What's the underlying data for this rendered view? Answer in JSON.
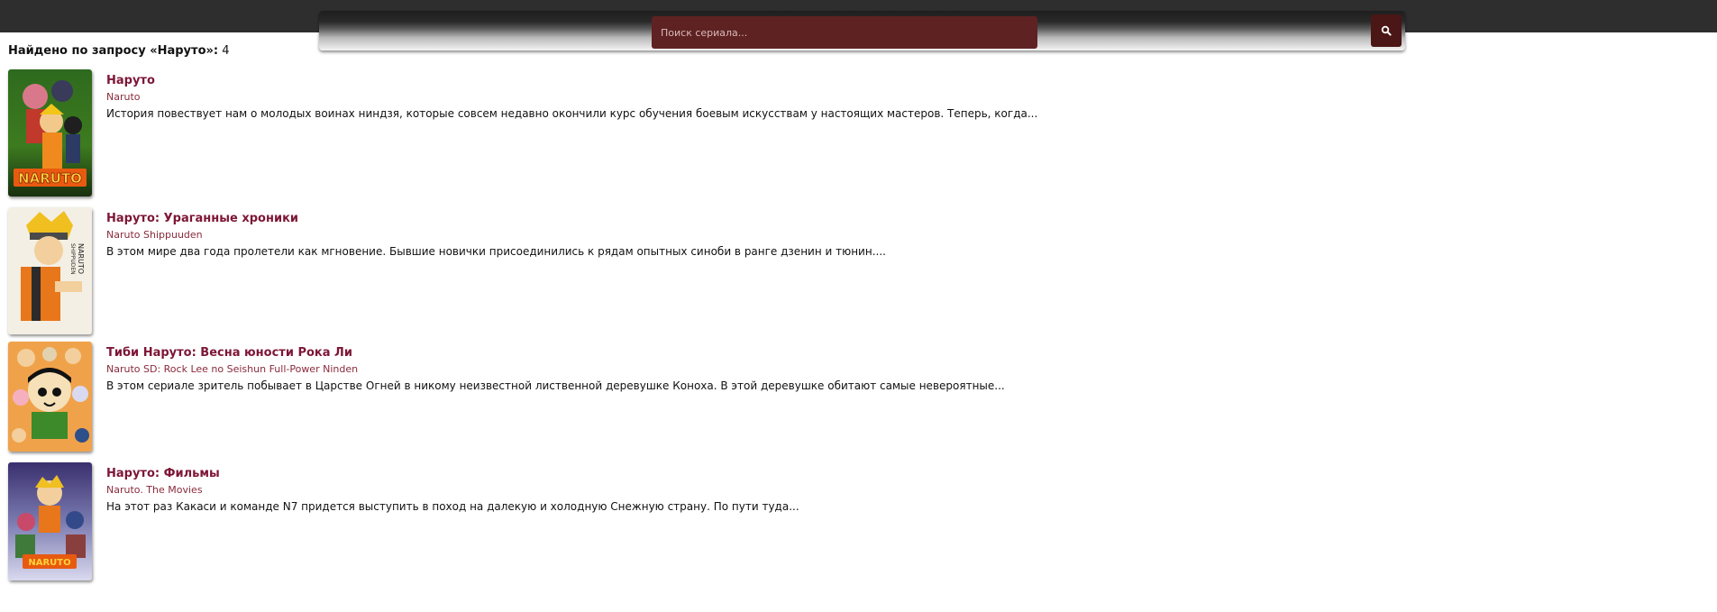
{
  "search": {
    "placeholder": "Поиск сериала...",
    "button_icon": "search-icon"
  },
  "summary": {
    "label": "Найдено по запросу «Наруто»:",
    "count": "4"
  },
  "colors": {
    "header_bg": "#2e2e2e",
    "search_input_bg": "#5e2222",
    "search_button_bg": "#4a1616",
    "title_color": "#7d1636"
  },
  "results": [
    {
      "title": "Наруто",
      "original": "Naruto",
      "description": "История повествует нам о молодых воинах ниндзя, которые совсем недавно окончили курс обучения боевым искусствам у настоящих мастеров. Теперь, когда..."
    },
    {
      "title": "Наруто: Ураганные хроники",
      "original": "Naruto Shippuuden",
      "description": "В этом мире два года пролетели как мгновение. Бывшие новички присоединились к рядам опытных синоби в ранге дзенин и тюнин...."
    },
    {
      "title": "Тиби Наруто: Весна юности Рока Ли",
      "original": "Naruto SD: Rock Lee no Seishun Full-Power Ninden",
      "description": "В этом сериале зритель побывает в Царстве Огней в никому неизвестной лиственной деревушке Коноха. В этой деревушке обитают самые невероятные..."
    },
    {
      "title": "Наруто: Фильмы",
      "original": "Naruto. The Movies",
      "description": "На этот раз Какаси и команде N7 придется выступить в поход на далекую и холодную Снежную страну. По пути туда..."
    }
  ]
}
